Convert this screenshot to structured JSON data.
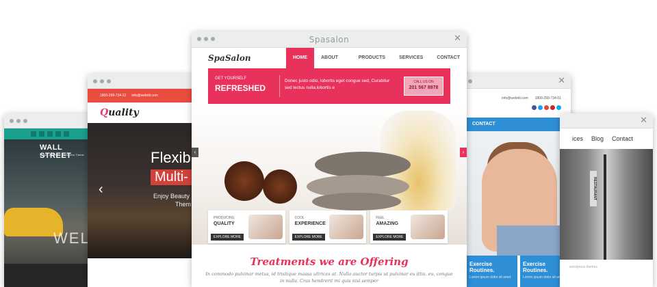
{
  "windows": {
    "wallstreet": {
      "logo": "WALL STREET",
      "tagline": "Simple & Flexible Wordpress Theme",
      "hero_text": "WELC"
    },
    "quality": {
      "phone": "1800-299-734-22",
      "email": "info@webriti.com",
      "logo_q": "Q",
      "logo_rest": "uality",
      "hero_line1": "Flexib",
      "hero_line2": "Multi-",
      "hero_line3": "Enjoy Beauty",
      "hero_line4": "Them"
    },
    "spasalon": {
      "title": "Spasalon",
      "logo": "SpaSalon",
      "menu": [
        "HOME",
        "ABOUT US",
        "PRODUCTS",
        "SERVICES",
        "CONTACT"
      ],
      "banner_small": "GET YOURSELF",
      "banner_big": "REFRESHED",
      "banner_text": "Donec justo odio, lobortis eget congue sed, Curabitur sed lectus nulla.lobortis e",
      "call_label": "CALL US ON",
      "call_number": "201 567 8978",
      "boxes": [
        {
          "small": "PRODUCING",
          "big": "QUALITY",
          "button": "EXPLORE MORE"
        },
        {
          "small": "COOL",
          "big": "EXPERIENCE",
          "button": "EXPLORE MORE"
        },
        {
          "small": "FEEL",
          "big": "AMAZING",
          "button": "EXPLORE MORE"
        }
      ],
      "section_heading": "Treatments we are Offering",
      "section_text": "In commodo pulvinar metus, id tristique massa ultrices at. Nulla auctor turpis ut pulvinar eu ittis. eu, congue in nulla. Cras hendrerit mi quis nisi semper"
    },
    "exercise": {
      "email": "info@webriti.com",
      "phone": "1800-299-734-01",
      "nav_item": "CONTACT",
      "card1": "Exercise Routines.",
      "card1_sub": "Lorem ipsum dolor sit amet",
      "card2": "Exercise Routines.",
      "card2_sub": "Lorem ipsum dolor sit amet"
    },
    "restaurant": {
      "nav": [
        "ices",
        "Blog",
        "Contact"
      ],
      "sign": "RESTAURANT",
      "footer_text": "wordpress themes"
    }
  },
  "colors": {
    "spa_accent": "#e8315b",
    "quality_red": "#ea4c3f",
    "wallstreet_teal": "#1aa08e",
    "exercise_blue": "#2f8fd6"
  }
}
